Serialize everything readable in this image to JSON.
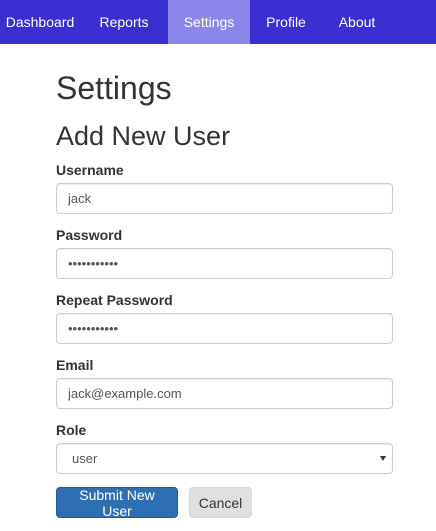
{
  "nav": {
    "items": [
      {
        "label": "Dashboard",
        "active": false
      },
      {
        "label": "Reports",
        "active": false
      },
      {
        "label": "Settings",
        "active": true
      },
      {
        "label": "Profile",
        "active": false
      },
      {
        "label": "About",
        "active": false
      }
    ]
  },
  "page": {
    "title": "Settings",
    "form_title": "Add New User"
  },
  "form": {
    "username": {
      "label": "Username",
      "value": "jack"
    },
    "password": {
      "label": "Password",
      "value": "•••••••••••"
    },
    "repeat_password": {
      "label": "Repeat Password",
      "value": "•••••••••••"
    },
    "email": {
      "label": "Email",
      "value": "jack@example.com"
    },
    "role": {
      "label": "Role",
      "value": "user"
    },
    "submit_label": "Submit New User",
    "cancel_label": "Cancel"
  },
  "colors": {
    "navbar_bg": "#3a2fd0",
    "navbar_active_bg": "#8c86ea",
    "primary_button": "#2e6fb3"
  }
}
